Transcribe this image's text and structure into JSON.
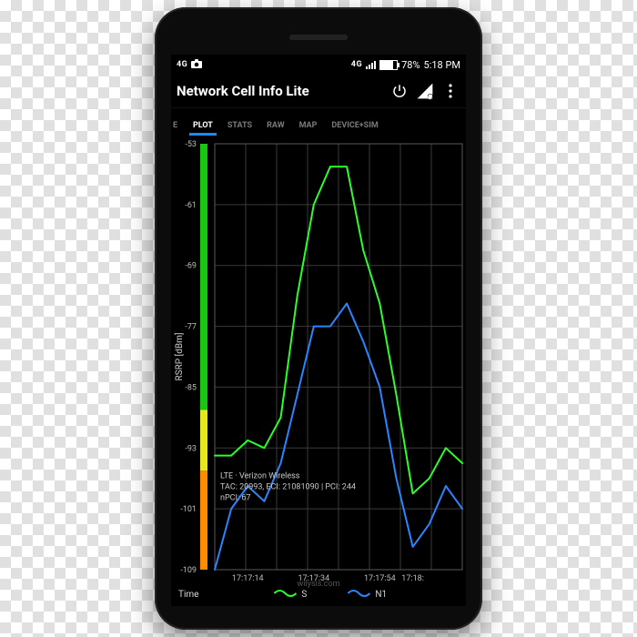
{
  "status": {
    "net_badge": "4G",
    "net_badge2": "4G",
    "battery": "78%",
    "time": "5:18 PM"
  },
  "header": {
    "title": "Network Cell Info Lite"
  },
  "tabs": [
    {
      "label": "E",
      "active": false
    },
    {
      "label": "PLOT",
      "active": true
    },
    {
      "label": "STATS",
      "active": false
    },
    {
      "label": "RAW",
      "active": false
    },
    {
      "label": "MAP",
      "active": false
    },
    {
      "label": "DEVICE+SIM",
      "active": false
    }
  ],
  "brand": "wilysis.com",
  "info_overlay": {
    "line1": "LTE · Verizon Wireless",
    "line2": "TAC: 20993, ECI: 21081090 | PCI: 244",
    "line3": "nPCI: 67"
  },
  "legend": {
    "xlabel": "Time",
    "s": "S",
    "n1": "N1"
  },
  "color_bar": [
    {
      "from": -53,
      "to": -88,
      "color": "#18c613"
    },
    {
      "from": -88,
      "to": -96,
      "color": "#e7e71d"
    },
    {
      "from": -96,
      "to": -109,
      "color": "#ff8b00"
    }
  ],
  "chart_data": {
    "type": "line",
    "title": "",
    "xlabel": "Time",
    "ylabel": "RSRP [dBm]",
    "ylim": [
      -109,
      -53
    ],
    "yticks": [
      -53,
      -61,
      -69,
      -77,
      -85,
      -93,
      -101,
      -109
    ],
    "x": [
      "17:17:04",
      "17:17:09",
      "17:17:14",
      "17:17:19",
      "17:17:24",
      "17:17:29",
      "17:17:34",
      "17:17:39",
      "17:17:44",
      "17:17:49",
      "17:17:54",
      "17:17:59",
      "17:18:04",
      "17:18:09",
      "17:18:14",
      "17:18:18"
    ],
    "xticks": [
      "17:17:14",
      "17:17:34",
      "17:17:54",
      "17:18:"
    ],
    "series": [
      {
        "name": "S",
        "color": "#2bff2b",
        "values": [
          -94,
          -94,
          -92,
          -93,
          -89,
          -73,
          -61,
          -56,
          -56,
          -67,
          -74,
          -86,
          -99,
          -97,
          -93,
          -95
        ]
      },
      {
        "name": "N1",
        "color": "#2a86ff",
        "values": [
          -109,
          -101,
          -98,
          -100,
          -95,
          -86,
          -77,
          -77,
          -74,
          -79,
          -85,
          -97,
          -106,
          -103,
          -98,
          -101
        ]
      }
    ]
  }
}
